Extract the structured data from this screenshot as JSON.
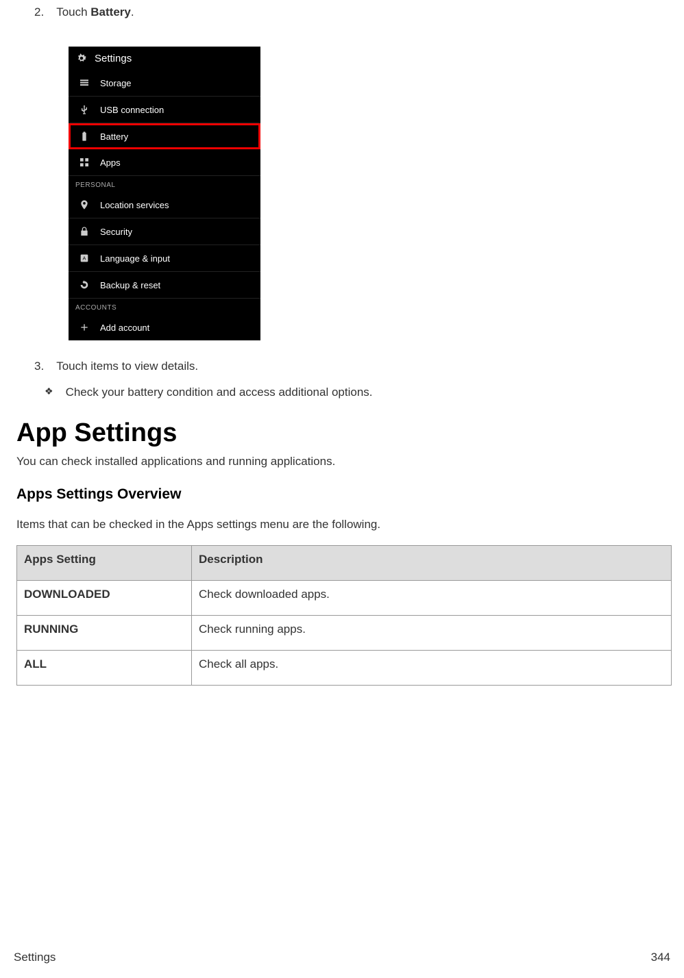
{
  "step2": {
    "num": "2.",
    "prefix": "Touch ",
    "bold": "Battery",
    "suffix": "."
  },
  "screenshot": {
    "header": "Settings",
    "rows1": [
      {
        "icon": "storage-icon",
        "label": "Storage"
      },
      {
        "icon": "usb-icon",
        "label": "USB connection"
      }
    ],
    "highlighted": {
      "icon": "battery-icon",
      "label": "Battery"
    },
    "rows2": [
      {
        "icon": "apps-icon",
        "label": "Apps"
      }
    ],
    "section1": "PERSONAL",
    "rows3": [
      {
        "icon": "location-icon",
        "label": "Location services"
      },
      {
        "icon": "lock-icon",
        "label": "Security"
      },
      {
        "icon": "language-icon",
        "label": "Language & input"
      },
      {
        "icon": "backup-icon",
        "label": "Backup & reset"
      }
    ],
    "section2": "ACCOUNTS",
    "rows4": [
      {
        "icon": "plus-icon",
        "label": "Add account"
      }
    ]
  },
  "step3": {
    "num": "3.",
    "text": "Touch items to view details."
  },
  "bullet": {
    "sym": "❖",
    "text": "Check your battery condition and access additional options."
  },
  "h1": "App Settings",
  "subtext": "You can check installed applications and running applications.",
  "h2": "Apps Settings Overview",
  "desc": "Items that can be checked in the Apps settings menu are the following.",
  "table": {
    "th1": "Apps Setting",
    "th2": "Description",
    "rows": [
      {
        "label": "DOWNLOADED",
        "desc": "Check downloaded apps."
      },
      {
        "label": "RUNNING",
        "desc": "Check running apps."
      },
      {
        "label": "ALL",
        "desc": "Check all apps."
      }
    ]
  },
  "footer": {
    "left": "Settings",
    "right": "344"
  }
}
